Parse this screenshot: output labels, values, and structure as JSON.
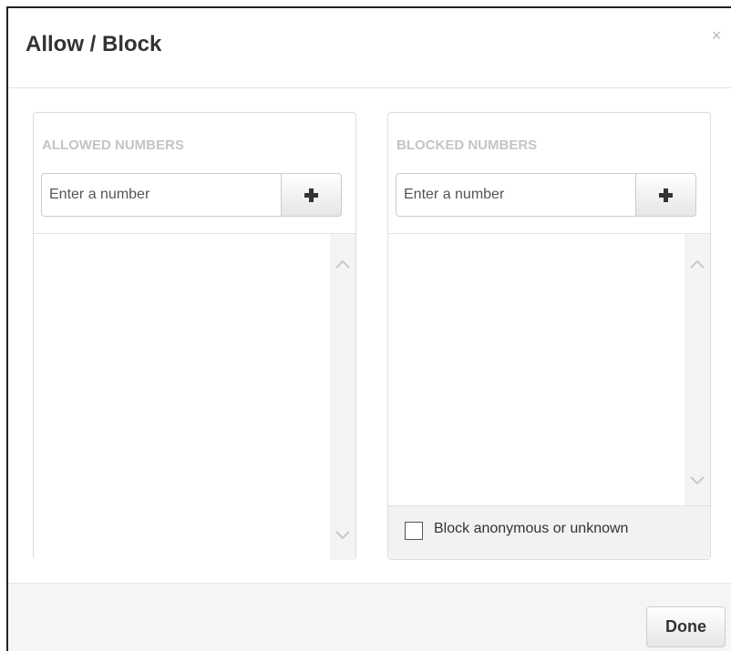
{
  "dialog": {
    "title": "Allow / Block",
    "close_label": "×"
  },
  "allowed": {
    "heading": "ALLOWED NUMBERS",
    "input_placeholder": "Enter a number",
    "input_value": "",
    "items": []
  },
  "blocked": {
    "heading": "BLOCKED NUMBERS",
    "input_placeholder": "Enter a number",
    "input_value": "",
    "items": [],
    "anonymous_checkbox_label": "Block anonymous or unknown",
    "anonymous_checked": false
  },
  "footer": {
    "done_label": "Done"
  },
  "icons": {
    "add": "plus-icon",
    "close": "close-icon",
    "scroll_up": "chevron-up-icon",
    "scroll_down": "chevron-down-icon"
  },
  "colors": {
    "heading_muted": "#c4c4c4",
    "footer_bg": "#f5f5f5",
    "scrollbar_bg": "#f4f4f4"
  }
}
